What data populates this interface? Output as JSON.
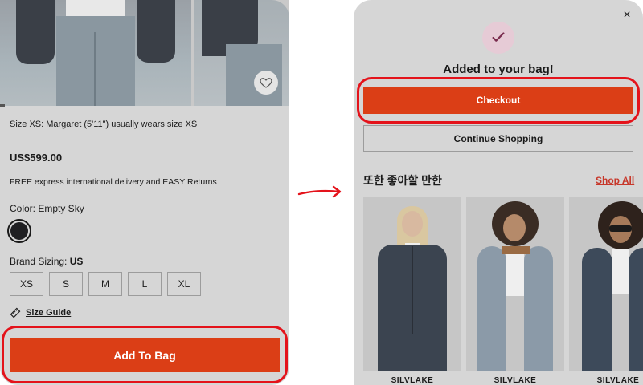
{
  "left_screen": {
    "size_note": "Size XS: Margaret (5'11\") usually wears size XS",
    "price": "US$599.00",
    "shipping": "FREE express international delivery and EASY Returns",
    "color_label": "Color: Empty Sky",
    "brand_sizing_label": "Brand Sizing:",
    "brand_sizing_value": "US",
    "sizes": [
      "XS",
      "S",
      "M",
      "L",
      "XL"
    ],
    "size_guide": "Size Guide",
    "add_to_bag": "Add To Bag",
    "icons": [
      "heart-icon",
      "ruler-icon"
    ]
  },
  "right_screen": {
    "close_symbol": "×",
    "confirmation": "Added to your bag!",
    "checkout": "Checkout",
    "continue_shopping": "Continue Shopping",
    "recommendations_title": "또한 좋아할 만한",
    "shop_all": "Shop All",
    "products": [
      {
        "name": "SILVLAKE"
      },
      {
        "name": "SILVLAKE"
      },
      {
        "name": "SILVLAKE"
      }
    ],
    "icons": [
      "close-icon",
      "check-icon"
    ]
  },
  "colors": {
    "accent": "#db3e16",
    "highlight_outline": "#e4131b",
    "overlay_bg": "#d6d6d6",
    "shop_all": "#c7372a"
  }
}
